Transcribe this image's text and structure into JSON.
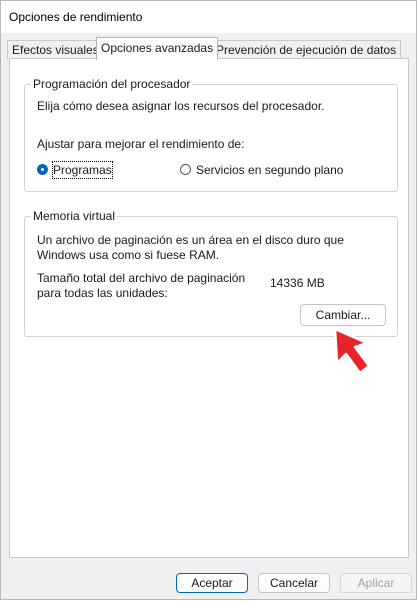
{
  "window": {
    "title": "Opciones de rendimiento"
  },
  "tabs": [
    {
      "label": "Efectos visuales",
      "active": false
    },
    {
      "label": "Opciones avanzadas",
      "active": true
    },
    {
      "label": "Prevención de ejecución de datos",
      "active": false
    }
  ],
  "processor_scheduling": {
    "legend": "Programación del procesador",
    "description": "Elija cómo desea asignar los recursos del procesador.",
    "adjust_label": "Ajustar para mejorar el rendimiento de:",
    "options": [
      {
        "label": "Programas",
        "selected": true
      },
      {
        "label": "Servicios en segundo plano",
        "selected": false
      }
    ]
  },
  "virtual_memory": {
    "legend": "Memoria virtual",
    "description_line1": "Un archivo de paginación es un área en el disco duro que",
    "description_line2": "Windows usa como si fuese RAM.",
    "total_label_line1": "Tamaño total del archivo de paginación",
    "total_label_line2": "para todas las unidades:",
    "total_value": "14336 MB",
    "change_button": "Cambiar..."
  },
  "footer": {
    "accept": "Aceptar",
    "cancel": "Cancelar",
    "apply": "Aplicar"
  },
  "colors": {
    "accent": "#0067c0",
    "pointer_arrow": "#e8242b"
  },
  "icons": {
    "pointer": "red-arrow-pointer-icon"
  }
}
